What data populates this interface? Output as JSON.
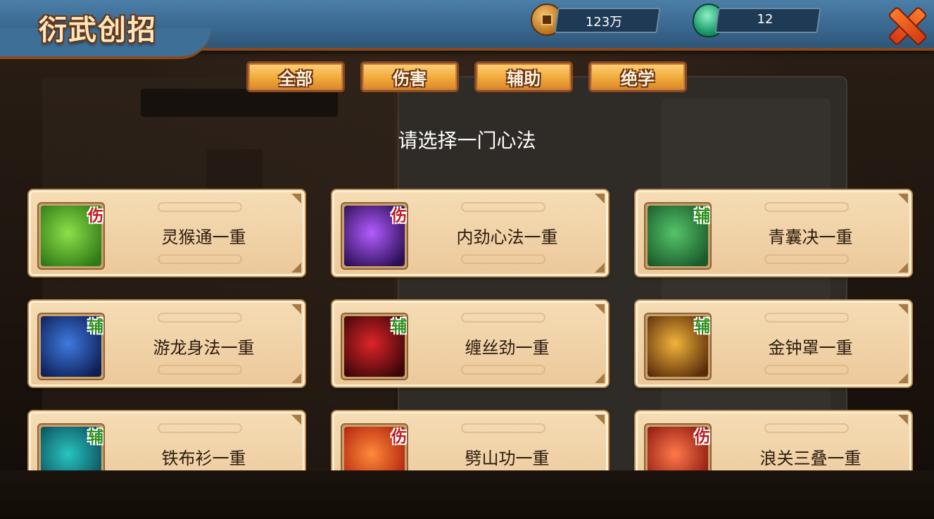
{
  "header": {
    "title": "衍武创招",
    "coins": "123万",
    "jade": "12"
  },
  "tabs": [
    {
      "label": "全部"
    },
    {
      "label": "伤害"
    },
    {
      "label": "辅助"
    },
    {
      "label": "绝学"
    }
  ],
  "prompt": "请选择一门心法",
  "skills": [
    {
      "name": "灵猴通一重",
      "badge": "伤",
      "type": "damage",
      "icon": "green-monkey-icon",
      "colors": [
        "#8ee04a",
        "#2e7a17"
      ]
    },
    {
      "name": "内劲心法一重",
      "badge": "伤",
      "type": "damage",
      "icon": "purple-eye-swirl-icon",
      "colors": [
        "#b35cff",
        "#2b0f55"
      ]
    },
    {
      "name": "青囊决一重",
      "badge": "辅",
      "type": "support",
      "icon": "old-sage-icon",
      "colors": [
        "#55c46a",
        "#1a5a2a"
      ]
    },
    {
      "name": "游龙身法一重",
      "badge": "辅",
      "type": "support",
      "icon": "dash-boot-icon",
      "colors": [
        "#3f7be0",
        "#0d1e55"
      ]
    },
    {
      "name": "缠丝劲一重",
      "badge": "辅",
      "type": "support",
      "icon": "red-blood-icon",
      "colors": [
        "#e0242a",
        "#3a0608"
      ]
    },
    {
      "name": "金钟罩一重",
      "badge": "辅",
      "type": "support",
      "icon": "golden-armor-icon",
      "colors": [
        "#f3b43a",
        "#5a2d0a"
      ]
    },
    {
      "name": "铁布衫一重",
      "badge": "辅",
      "type": "support",
      "icon": "iron-armor-icon",
      "colors": [
        "#28c6c0",
        "#0c4a5a"
      ]
    },
    {
      "name": "劈山功一重",
      "badge": "伤",
      "type": "damage",
      "icon": "fire-slash-icon",
      "colors": [
        "#ff8a3a",
        "#b0200c"
      ]
    },
    {
      "name": "浪关三叠一重",
      "badge": "伤",
      "type": "damage",
      "icon": "red-wave-icon",
      "colors": [
        "#ff7a4a",
        "#8a1510"
      ]
    }
  ]
}
